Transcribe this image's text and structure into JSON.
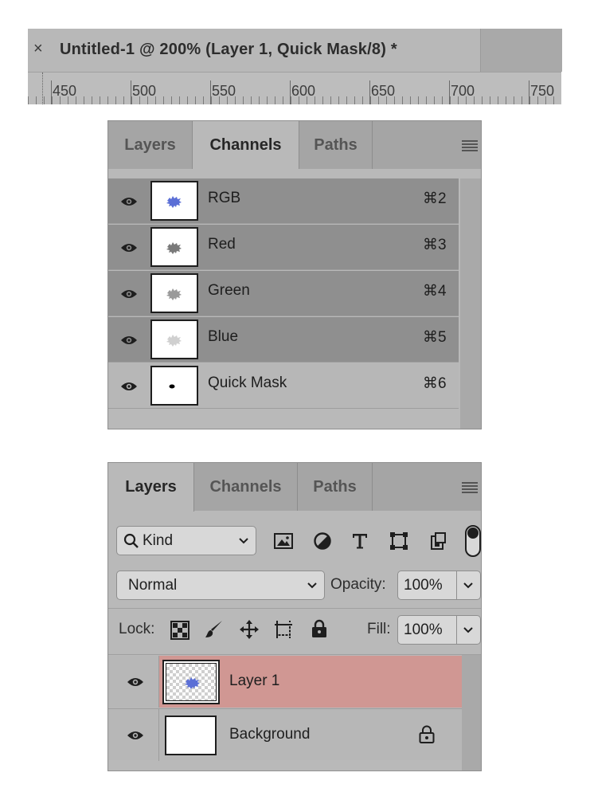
{
  "document": {
    "close_glyph": "×",
    "title": "Untitled-1 @ 200% (Layer 1, Quick Mask/8) *"
  },
  "ruler": {
    "labels": [
      "450",
      "500",
      "550",
      "600",
      "650",
      "700",
      "750"
    ]
  },
  "channels_panel": {
    "tabs": [
      "Layers",
      "Channels",
      "Paths"
    ],
    "active_tab": "Channels",
    "menu_icon": "panel-menu-icon",
    "channels": [
      {
        "name": "RGB",
        "shortcut": "⌘2",
        "visible": true,
        "selected": true,
        "thumb_color": "#5b6fd6"
      },
      {
        "name": "Red",
        "shortcut": "⌘3",
        "visible": true,
        "selected": true,
        "thumb_color": "#7a7a7a"
      },
      {
        "name": "Green",
        "shortcut": "⌘4",
        "visible": true,
        "selected": true,
        "thumb_color": "#9a9a9a"
      },
      {
        "name": "Blue",
        "shortcut": "⌘5",
        "visible": true,
        "selected": true,
        "thumb_color": "#d0d0d0"
      },
      {
        "name": "Quick Mask",
        "shortcut": "⌘6",
        "visible": true,
        "selected": false,
        "thumb_color": "#000000"
      }
    ]
  },
  "layers_panel": {
    "tabs": [
      "Layers",
      "Channels",
      "Paths"
    ],
    "active_tab": "Layers",
    "filter": {
      "search_icon": "magnifier-icon",
      "value": "Kind"
    },
    "filter_icons": [
      "image-icon",
      "adjustment-icon",
      "type-icon",
      "shape-icon",
      "smart-object-icon",
      "filter-toggle-icon"
    ],
    "blend_mode": "Normal",
    "opacity_label": "Opacity:",
    "opacity_value": "100%",
    "lock_label": "Lock:",
    "lock_icons": [
      "lock-transparent-pixels-icon",
      "lock-image-pixels-icon",
      "lock-position-icon",
      "lock-artboard-icon",
      "lock-all-icon"
    ],
    "fill_label": "Fill:",
    "fill_value": "100%",
    "layers": [
      {
        "name": "Layer 1",
        "visible": true,
        "selected": true,
        "locked": false
      },
      {
        "name": "Background",
        "visible": true,
        "selected": false,
        "locked": true
      }
    ],
    "colors": {
      "selected_layer": "#d09793",
      "panel_bg": "#b9b9b9"
    }
  }
}
